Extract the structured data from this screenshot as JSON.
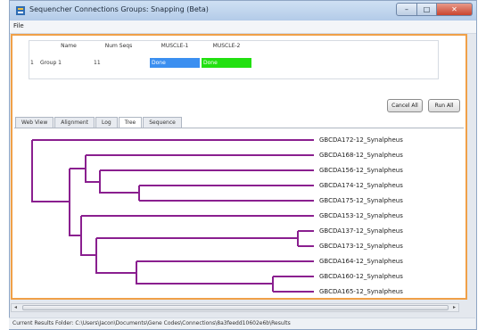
{
  "window": {
    "title": "Sequencher Connections Groups: Snapping (Beta)",
    "controls": {
      "minimize": "–",
      "maximize": "□",
      "close": "✕"
    }
  },
  "menu": {
    "file": "File"
  },
  "groups_table": {
    "columns": [
      "Name",
      "Num Seqs",
      "MUSCLE-1",
      "MUSCLE-2"
    ],
    "rows": [
      {
        "index": "1",
        "name": "Group 1",
        "num_seqs": "11",
        "muscle1": "Done",
        "muscle2": "Done"
      }
    ],
    "status_colors": {
      "muscle1": "#3b8ff0",
      "muscle2": "#22e010"
    }
  },
  "buttons": {
    "cancel_all": "Cancel All",
    "run_all": "Run All"
  },
  "tabs": [
    "Web View",
    "Alignment",
    "Log",
    "Tree",
    "Sequence"
  ],
  "active_tab": "Tree",
  "tree": {
    "branch_color": "#8a1f8f",
    "leaves": [
      "GBCDA172-12_Synalpheus",
      "GBCDA168-12_Synalpheus",
      "GBCDA156-12_Synalpheus",
      "GBCDA174-12_Synalpheus",
      "GBCDA175-12_Synalpheus",
      "GBCDA153-12_Synalpheus",
      "GBCDA137-12_Synalpheus",
      "GBCDA173-12_Synalpheus",
      "GBCDA164-12_Synalpheus",
      "GBCDA160-12_Synalpheus",
      "GBCDA165-12_Synalpheus"
    ]
  },
  "status_bar": {
    "text": "Current Results Folder: C:\\Users\\Jacon\\Documents\\Gene Codes\\Connections\\8a3feedd10602e6b\\Results"
  }
}
